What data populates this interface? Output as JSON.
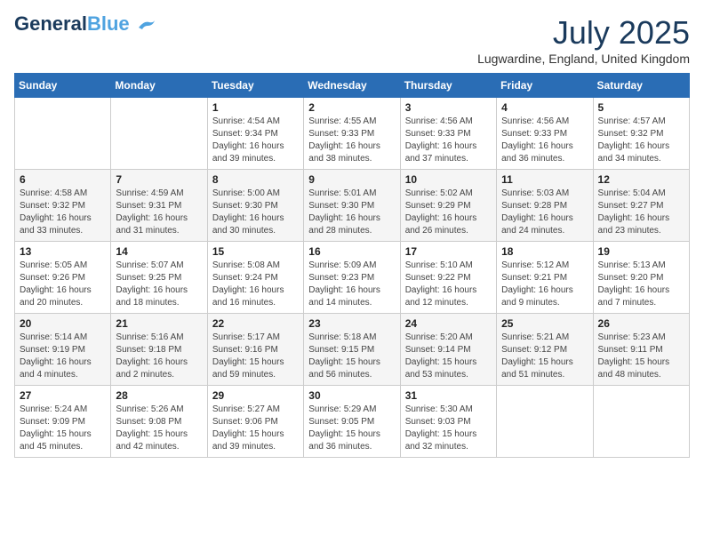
{
  "header": {
    "logo_general": "General",
    "logo_blue": "Blue",
    "month_title": "July 2025",
    "location": "Lugwardine, England, United Kingdom"
  },
  "calendar": {
    "columns": [
      "Sunday",
      "Monday",
      "Tuesday",
      "Wednesday",
      "Thursday",
      "Friday",
      "Saturday"
    ],
    "weeks": [
      [
        {
          "day": "",
          "sunrise": "",
          "sunset": "",
          "daylight": ""
        },
        {
          "day": "",
          "sunrise": "",
          "sunset": "",
          "daylight": ""
        },
        {
          "day": "1",
          "sunrise": "Sunrise: 4:54 AM",
          "sunset": "Sunset: 9:34 PM",
          "daylight": "Daylight: 16 hours and 39 minutes."
        },
        {
          "day": "2",
          "sunrise": "Sunrise: 4:55 AM",
          "sunset": "Sunset: 9:33 PM",
          "daylight": "Daylight: 16 hours and 38 minutes."
        },
        {
          "day": "3",
          "sunrise": "Sunrise: 4:56 AM",
          "sunset": "Sunset: 9:33 PM",
          "daylight": "Daylight: 16 hours and 37 minutes."
        },
        {
          "day": "4",
          "sunrise": "Sunrise: 4:56 AM",
          "sunset": "Sunset: 9:33 PM",
          "daylight": "Daylight: 16 hours and 36 minutes."
        },
        {
          "day": "5",
          "sunrise": "Sunrise: 4:57 AM",
          "sunset": "Sunset: 9:32 PM",
          "daylight": "Daylight: 16 hours and 34 minutes."
        }
      ],
      [
        {
          "day": "6",
          "sunrise": "Sunrise: 4:58 AM",
          "sunset": "Sunset: 9:32 PM",
          "daylight": "Daylight: 16 hours and 33 minutes."
        },
        {
          "day": "7",
          "sunrise": "Sunrise: 4:59 AM",
          "sunset": "Sunset: 9:31 PM",
          "daylight": "Daylight: 16 hours and 31 minutes."
        },
        {
          "day": "8",
          "sunrise": "Sunrise: 5:00 AM",
          "sunset": "Sunset: 9:30 PM",
          "daylight": "Daylight: 16 hours and 30 minutes."
        },
        {
          "day": "9",
          "sunrise": "Sunrise: 5:01 AM",
          "sunset": "Sunset: 9:30 PM",
          "daylight": "Daylight: 16 hours and 28 minutes."
        },
        {
          "day": "10",
          "sunrise": "Sunrise: 5:02 AM",
          "sunset": "Sunset: 9:29 PM",
          "daylight": "Daylight: 16 hours and 26 minutes."
        },
        {
          "day": "11",
          "sunrise": "Sunrise: 5:03 AM",
          "sunset": "Sunset: 9:28 PM",
          "daylight": "Daylight: 16 hours and 24 minutes."
        },
        {
          "day": "12",
          "sunrise": "Sunrise: 5:04 AM",
          "sunset": "Sunset: 9:27 PM",
          "daylight": "Daylight: 16 hours and 23 minutes."
        }
      ],
      [
        {
          "day": "13",
          "sunrise": "Sunrise: 5:05 AM",
          "sunset": "Sunset: 9:26 PM",
          "daylight": "Daylight: 16 hours and 20 minutes."
        },
        {
          "day": "14",
          "sunrise": "Sunrise: 5:07 AM",
          "sunset": "Sunset: 9:25 PM",
          "daylight": "Daylight: 16 hours and 18 minutes."
        },
        {
          "day": "15",
          "sunrise": "Sunrise: 5:08 AM",
          "sunset": "Sunset: 9:24 PM",
          "daylight": "Daylight: 16 hours and 16 minutes."
        },
        {
          "day": "16",
          "sunrise": "Sunrise: 5:09 AM",
          "sunset": "Sunset: 9:23 PM",
          "daylight": "Daylight: 16 hours and 14 minutes."
        },
        {
          "day": "17",
          "sunrise": "Sunrise: 5:10 AM",
          "sunset": "Sunset: 9:22 PM",
          "daylight": "Daylight: 16 hours and 12 minutes."
        },
        {
          "day": "18",
          "sunrise": "Sunrise: 5:12 AM",
          "sunset": "Sunset: 9:21 PM",
          "daylight": "Daylight: 16 hours and 9 minutes."
        },
        {
          "day": "19",
          "sunrise": "Sunrise: 5:13 AM",
          "sunset": "Sunset: 9:20 PM",
          "daylight": "Daylight: 16 hours and 7 minutes."
        }
      ],
      [
        {
          "day": "20",
          "sunrise": "Sunrise: 5:14 AM",
          "sunset": "Sunset: 9:19 PM",
          "daylight": "Daylight: 16 hours and 4 minutes."
        },
        {
          "day": "21",
          "sunrise": "Sunrise: 5:16 AM",
          "sunset": "Sunset: 9:18 PM",
          "daylight": "Daylight: 16 hours and 2 minutes."
        },
        {
          "day": "22",
          "sunrise": "Sunrise: 5:17 AM",
          "sunset": "Sunset: 9:16 PM",
          "daylight": "Daylight: 15 hours and 59 minutes."
        },
        {
          "day": "23",
          "sunrise": "Sunrise: 5:18 AM",
          "sunset": "Sunset: 9:15 PM",
          "daylight": "Daylight: 15 hours and 56 minutes."
        },
        {
          "day": "24",
          "sunrise": "Sunrise: 5:20 AM",
          "sunset": "Sunset: 9:14 PM",
          "daylight": "Daylight: 15 hours and 53 minutes."
        },
        {
          "day": "25",
          "sunrise": "Sunrise: 5:21 AM",
          "sunset": "Sunset: 9:12 PM",
          "daylight": "Daylight: 15 hours and 51 minutes."
        },
        {
          "day": "26",
          "sunrise": "Sunrise: 5:23 AM",
          "sunset": "Sunset: 9:11 PM",
          "daylight": "Daylight: 15 hours and 48 minutes."
        }
      ],
      [
        {
          "day": "27",
          "sunrise": "Sunrise: 5:24 AM",
          "sunset": "Sunset: 9:09 PM",
          "daylight": "Daylight: 15 hours and 45 minutes."
        },
        {
          "day": "28",
          "sunrise": "Sunrise: 5:26 AM",
          "sunset": "Sunset: 9:08 PM",
          "daylight": "Daylight: 15 hours and 42 minutes."
        },
        {
          "day": "29",
          "sunrise": "Sunrise: 5:27 AM",
          "sunset": "Sunset: 9:06 PM",
          "daylight": "Daylight: 15 hours and 39 minutes."
        },
        {
          "day": "30",
          "sunrise": "Sunrise: 5:29 AM",
          "sunset": "Sunset: 9:05 PM",
          "daylight": "Daylight: 15 hours and 36 minutes."
        },
        {
          "day": "31",
          "sunrise": "Sunrise: 5:30 AM",
          "sunset": "Sunset: 9:03 PM",
          "daylight": "Daylight: 15 hours and 32 minutes."
        },
        {
          "day": "",
          "sunrise": "",
          "sunset": "",
          "daylight": ""
        },
        {
          "day": "",
          "sunrise": "",
          "sunset": "",
          "daylight": ""
        }
      ]
    ]
  }
}
